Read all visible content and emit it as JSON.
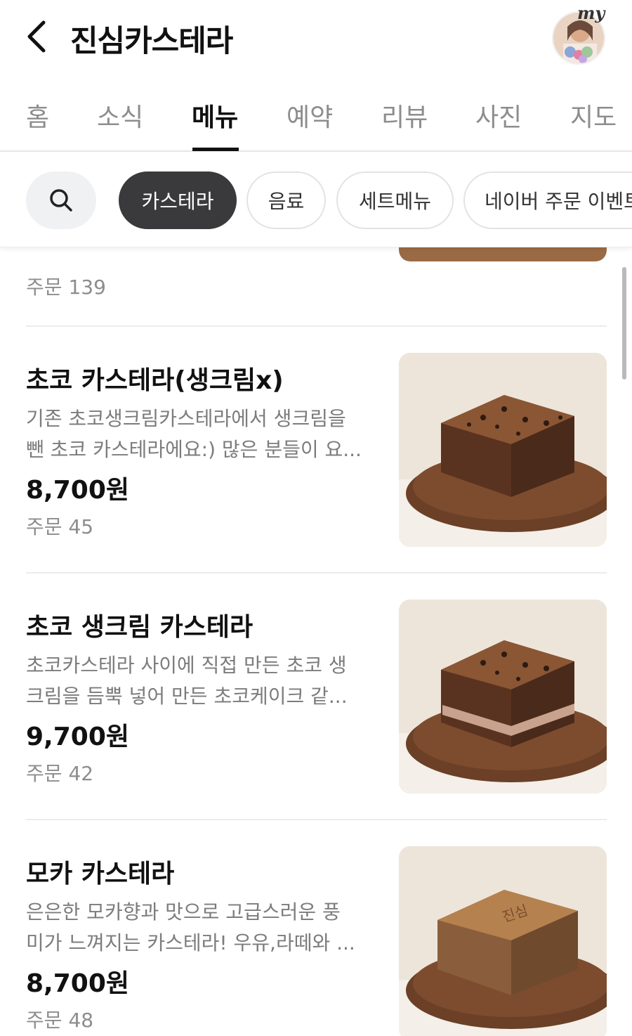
{
  "header": {
    "title": "진심카스테라",
    "avatar_label": "my"
  },
  "tabs": [
    {
      "label": "홈",
      "active": false
    },
    {
      "label": "소식",
      "active": false
    },
    {
      "label": "메뉴",
      "active": true
    },
    {
      "label": "예약",
      "active": false
    },
    {
      "label": "리뷰",
      "active": false
    },
    {
      "label": "사진",
      "active": false
    },
    {
      "label": "지도",
      "active": false
    }
  ],
  "filters": {
    "chips": [
      {
        "label": "카스테라",
        "active": true
      },
      {
        "label": "음료",
        "active": false
      },
      {
        "label": "세트메뉴",
        "active": false
      },
      {
        "label": "네이버 주문 이벤트",
        "active": false
      }
    ]
  },
  "order_prefix": "주문",
  "partial_item": {
    "orders": "139"
  },
  "items": [
    {
      "name": "초코 카스테라(생크림x)",
      "desc_line1": "기존 초코생크림카스테라에서 생크림을",
      "desc_line2": "뺀 초코 카스테라에요:) 많은 분들이 요...",
      "price": "8,700원",
      "orders": "45"
    },
    {
      "name": "초코 생크림 카스테라",
      "desc_line1": "초코카스테라 사이에 직접 만든 초코 생",
      "desc_line2": "크림을 듬뿍 넣어 만든 초코케이크 같...",
      "price": "9,700원",
      "orders": "42"
    },
    {
      "name": "모카 카스테라",
      "desc_line1": "은은한 모카향과 맛으로 고급스러운 풍",
      "desc_line2": "미가 느껴지는 카스테라! 우유,라떼와 ...",
      "price": "8,700원",
      "orders": "48"
    }
  ],
  "image_stamp": "진심",
  "colors": {
    "active_chip": "#3a3a3c",
    "inactive_text": "#8d8d8d",
    "divider": "#ececec"
  }
}
